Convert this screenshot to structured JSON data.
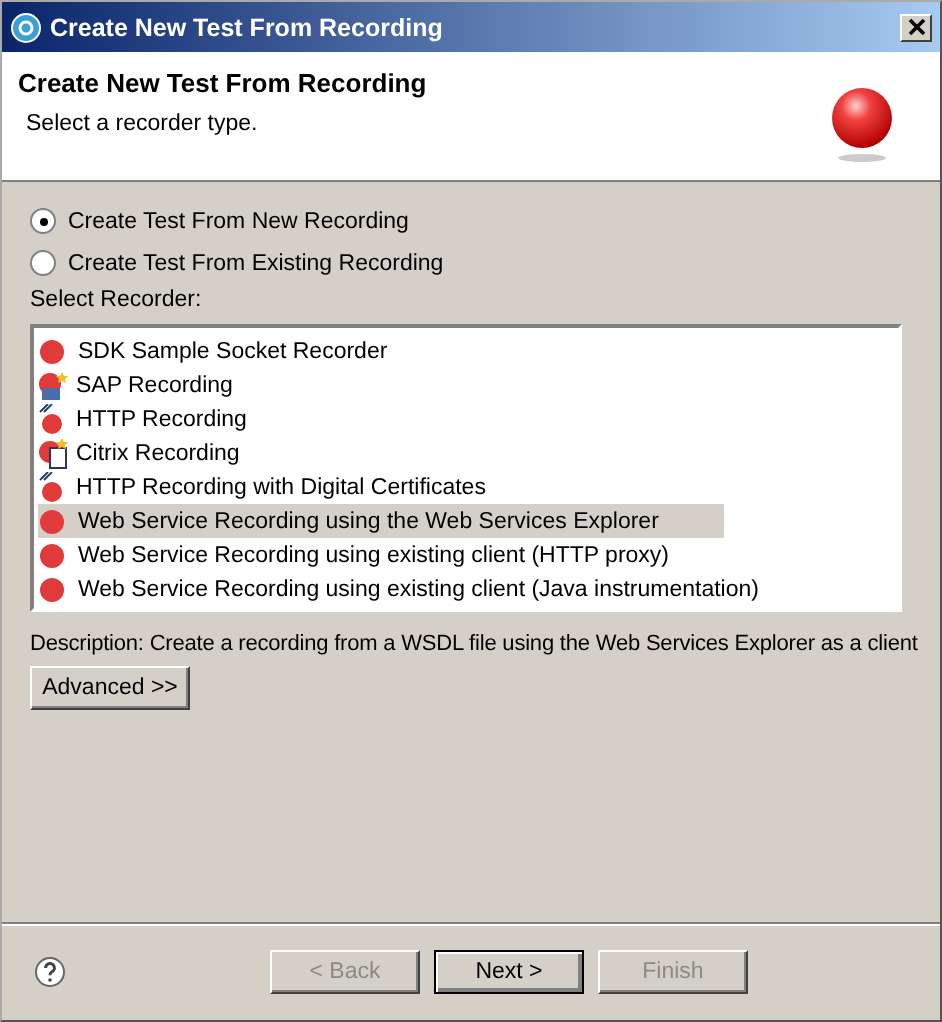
{
  "window": {
    "title": "Create New Test From Recording"
  },
  "header": {
    "title": "Create New Test From Recording",
    "subtitle": "Select a recorder type."
  },
  "modes": [
    {
      "label": "Create Test From New Recording",
      "selected": true
    },
    {
      "label": "Create Test From Existing Recording",
      "selected": false
    }
  ],
  "recorder_list": {
    "label": "Select Recorder:",
    "items": [
      {
        "label": "SDK Sample Socket Recorder",
        "kind": "plain",
        "selected": false
      },
      {
        "label": "SAP Recording",
        "kind": "sap",
        "selected": false
      },
      {
        "label": "HTTP Recording",
        "kind": "http",
        "selected": false
      },
      {
        "label": "Citrix Recording",
        "kind": "citrix",
        "selected": false
      },
      {
        "label": "HTTP Recording with Digital Certificates",
        "kind": "http",
        "selected": false
      },
      {
        "label": "Web Service Recording using the Web Services Explorer",
        "kind": "plain",
        "selected": true
      },
      {
        "label": "Web Service Recording using existing client (HTTP proxy)",
        "kind": "plain",
        "selected": false
      },
      {
        "label": "Web Service Recording using existing client (Java instrumentation)",
        "kind": "plain",
        "selected": false
      }
    ]
  },
  "description": "Description: Create a recording from a WSDL file using the Web Services Explorer as a client",
  "advanced_button": "Advanced >>",
  "buttons": [
    {
      "label": "< Back",
      "disabled": true,
      "default": false
    },
    {
      "label": "Next >",
      "disabled": false,
      "default": true
    },
    {
      "label": "Finish",
      "disabled": true,
      "default": false
    }
  ]
}
